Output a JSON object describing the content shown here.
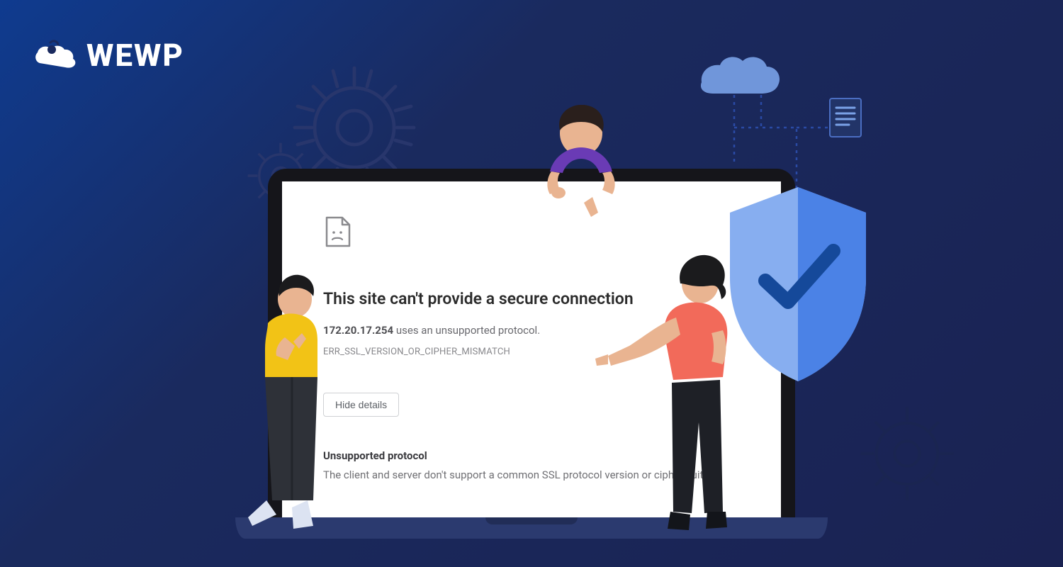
{
  "brand": {
    "name": "WEWP"
  },
  "error_page": {
    "title": "This site can't provide a secure connection",
    "ip": "172.20.17.254",
    "ip_suffix": "uses an unsupported protocol.",
    "code": "ERR_SSL_VERSION_OR_CIPHER_MISMATCH",
    "hide_details_label": "Hide details",
    "details_title": "Unsupported protocol",
    "details_body": "The client and server don't support a common SSL protocol version or cipher suite."
  },
  "icons": {
    "gear_large": "gear-icon",
    "gear_small": "gear-icon",
    "cloud": "cloud-icon",
    "document": "document-icon",
    "shield_check": "shield-check-icon",
    "sad_page": "sad-page-icon"
  },
  "colors": {
    "bg_grad_from": "#0f3b8f",
    "bg_grad_to": "#1a2252",
    "gear_stroke": "#28366c",
    "laptop_base": "#2b3a6f",
    "shield_light": "#87aef0",
    "shield_dark": "#4b82e6",
    "check": "#15499a"
  }
}
